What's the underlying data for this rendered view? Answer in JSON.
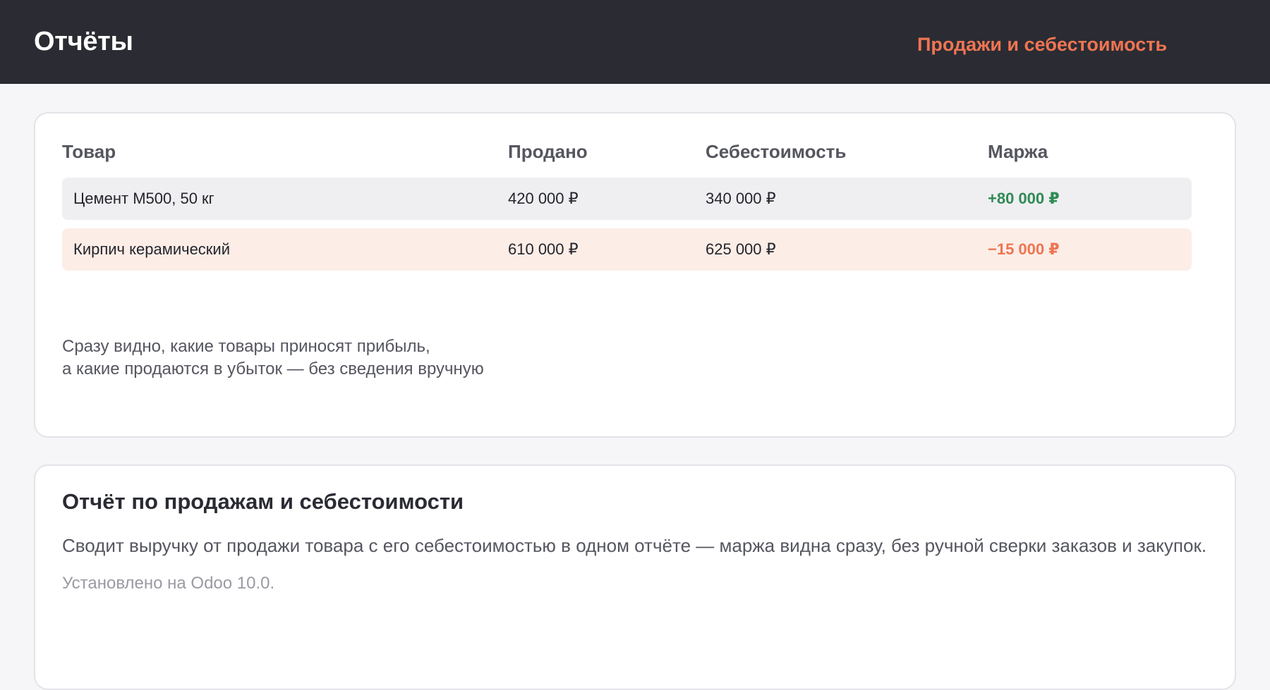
{
  "header": {
    "title": "Отчёты",
    "active_tab": "Продажи и себестоимость"
  },
  "report_table": {
    "columns": [
      "Товар",
      "Продано",
      "Себестоимость",
      "Маржа"
    ],
    "rows": [
      {
        "product": "Цемент М500, 50 кг",
        "sold": "420 000 ₽",
        "cost": "340 000 ₽",
        "margin": "+80 000 ₽",
        "status": "profit"
      },
      {
        "product": "Кирпич керамический",
        "sold": "610 000 ₽",
        "cost": "625 000 ₽",
        "margin": "−15 000 ₽",
        "status": "loss"
      }
    ],
    "note_lines": [
      "Сразу видно, какие товары приносят прибыль,",
      "а какие продаются в убыток — без сведения вручную"
    ]
  },
  "info_card": {
    "heading": "Отчёт по продажам и себестоимости",
    "description": "Сводит выручку от продажи товара с его себестоимостью в одном отчёте — маржа видна сразу, без ручной сверки заказов и закупок.",
    "installed": "Установлено на Odoo 10.0."
  },
  "colors": {
    "header_bg": "#2b2b33",
    "accent": "#ee7552",
    "profit": "#2f8a55",
    "loss": "#ee7552"
  }
}
